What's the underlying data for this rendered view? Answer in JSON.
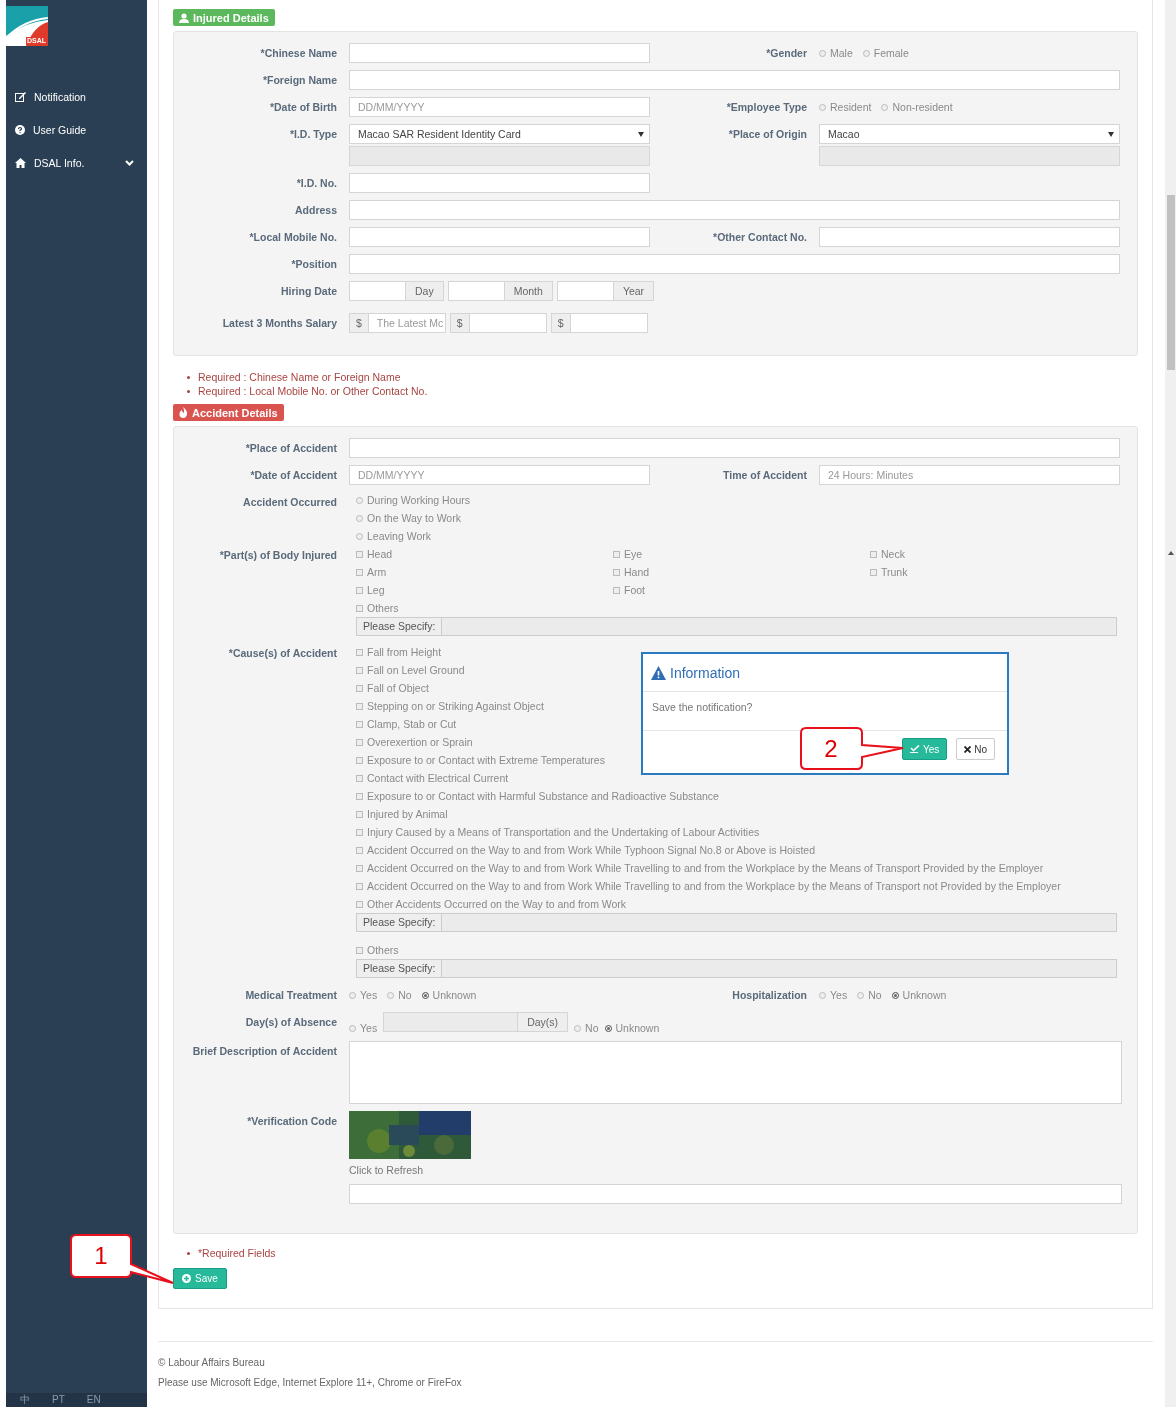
{
  "sidebar": {
    "logo_text": "DSAL",
    "items": [
      {
        "label": "Notification",
        "has_submenu": false
      },
      {
        "label": "User Guide",
        "has_submenu": false
      },
      {
        "label": "DSAL Info.",
        "has_submenu": true
      }
    ],
    "languages": [
      "中",
      "PT",
      "EN"
    ]
  },
  "injured": {
    "title": "Injured Details",
    "rows": [
      {
        "fields": [
          {
            "label": "*Chinese Name",
            "kind": "text"
          },
          {
            "label": "*Gender",
            "kind": "radio",
            "options": [
              {
                "label": "Male",
                "selected": false
              },
              {
                "label": "Female",
                "selected": false
              }
            ]
          }
        ]
      },
      {
        "fields": [
          {
            "label": "*Foreign Name",
            "kind": "text",
            "wide": true
          }
        ]
      },
      {
        "fields": [
          {
            "label": "*Date of Birth",
            "kind": "text",
            "placeholder": "DD/MM/YYYY"
          },
          {
            "label": "*Employee Type",
            "kind": "radio",
            "options": [
              {
                "label": "Resident",
                "selected": false
              },
              {
                "label": "Non-resident",
                "selected": false
              }
            ]
          }
        ]
      },
      {
        "fields": [
          {
            "label": "*I.D. Type",
            "kind": "select",
            "value": "Macao SAR Resident Identity Card",
            "extra_field": true
          },
          {
            "label": "*Place of Origin",
            "kind": "select",
            "value": "Macao",
            "extra_field": true
          }
        ]
      },
      {
        "fields": [
          {
            "label": "*I.D. No.",
            "kind": "text"
          }
        ]
      },
      {
        "fields": [
          {
            "label": "Address",
            "kind": "text",
            "wide": true
          }
        ]
      },
      {
        "fields": [
          {
            "label": "*Local Mobile No.",
            "kind": "text"
          },
          {
            "label": "*Other Contact No.",
            "kind": "text"
          }
        ]
      },
      {
        "fields": [
          {
            "label": "*Position",
            "kind": "text",
            "wide": true
          }
        ]
      },
      {
        "fields": [
          {
            "label": "Hiring Date",
            "kind": "date_parts",
            "parts": [
              "Day",
              "Month",
              "Year"
            ]
          }
        ]
      },
      {
        "fields": [
          {
            "label": "Latest 3 Months Salary",
            "kind": "salary",
            "groups": [
              {
                "prefix": "$",
                "placeholder": "The Latest Mc"
              },
              {
                "prefix": "$"
              },
              {
                "prefix": "$"
              }
            ]
          }
        ]
      }
    ]
  },
  "notes": [
    "Required : Chinese Name or Foreign Name",
    "Required : Local Mobile No. or Other Contact No."
  ],
  "accident": {
    "title": "Accident Details",
    "rows": [
      {
        "fields": [
          {
            "label": "*Place of Accident",
            "kind": "text",
            "wide": true
          }
        ]
      },
      {
        "fields": [
          {
            "label": "*Date of Accident",
            "kind": "text",
            "placeholder": "DD/MM/YYYY"
          },
          {
            "label": "Time of Accident",
            "kind": "text",
            "placeholder": "24 Hours: Minutes"
          }
        ]
      },
      {
        "fields": [
          {
            "label": "Accident Occurred",
            "kind": "radio_list",
            "options": [
              {
                "label": "During Working Hours",
                "selected": false
              },
              {
                "label": "On the Way to Work",
                "selected": false
              },
              {
                "label": "Leaving Work",
                "selected": false
              }
            ]
          }
        ]
      },
      {
        "fields": [
          {
            "label": "*Part(s) of Body Injured",
            "kind": "checkgrid",
            "options": [
              {
                "label": "Head",
                "checked": false
              },
              {
                "label": "Eye",
                "checked": false
              },
              {
                "label": "Neck",
                "checked": false
              },
              {
                "label": "Arm",
                "checked": false
              },
              {
                "label": "Hand",
                "checked": false
              },
              {
                "label": "Trunk",
                "checked": false
              },
              {
                "label": "Leg",
                "checked": false
              },
              {
                "label": "Foot",
                "checked": false
              }
            ],
            "other": {
              "label": "Others",
              "checked": false,
              "specify": "Please Specify:"
            }
          }
        ]
      },
      {
        "fields": [
          {
            "label": "*Cause(s) of Accident",
            "kind": "checklist",
            "options": [
              {
                "label": "Fall from Height",
                "checked": false
              },
              {
                "label": "Fall on Level Ground",
                "checked": false
              },
              {
                "label": "Fall of Object",
                "checked": false
              },
              {
                "label": "Stepping on or Striking Against Object",
                "checked": false
              },
              {
                "label": "Clamp, Stab or Cut",
                "checked": false
              },
              {
                "label": "Overexertion or Sprain",
                "checked": false
              },
              {
                "label": "Exposure to or Contact with Extreme Temperatures",
                "checked": false
              },
              {
                "label": "Contact with Electrical Current",
                "checked": false
              },
              {
                "label": "Exposure to or Contact with Harmful Substance and Radioactive Substance",
                "checked": false
              },
              {
                "label": "Injured by Animal",
                "checked": false
              },
              {
                "label": "Injury Caused by a Means of Transportation and the Undertaking of Labour Activities",
                "checked": false
              },
              {
                "label": "Accident Occurred on the Way to and from Work While Typhoon Signal No.8 or Above is Hoisted",
                "checked": false
              },
              {
                "label": "Accident Occurred on the Way to and from Work While Travelling to and from the Workplace by the Means of Transport Provided by the Employer",
                "checked": false
              },
              {
                "label": "Accident Occurred on the Way to and from Work While Travelling to and from the Workplace by the Means of Transport not Provided by the Employer",
                "checked": false
              },
              {
                "label": "Other Accidents Occurred on the Way to and from Work",
                "checked": false,
                "specify": "Please Specify:"
              },
              {
                "label": "Others",
                "checked": false,
                "specify": "Please Specify:"
              }
            ]
          }
        ]
      },
      {
        "fields": [
          {
            "label": "Medical Treatment",
            "kind": "radio",
            "options": [
              {
                "label": "Yes",
                "selected": false
              },
              {
                "label": "No",
                "selected": false
              },
              {
                "label": "Unknown",
                "selected": true
              }
            ]
          },
          {
            "label": "Hospitalization",
            "kind": "radio",
            "options": [
              {
                "label": "Yes",
                "selected": false
              },
              {
                "label": "No",
                "selected": false
              },
              {
                "label": "Unknown",
                "selected": true
              }
            ]
          }
        ]
      },
      {
        "fields": [
          {
            "label": "Day(s) of Absence",
            "kind": "absence",
            "unit": "Day(s)",
            "options": [
              {
                "label": "Yes",
                "selected": false
              },
              {
                "label": "No",
                "selected": false
              },
              {
                "label": "Unknown",
                "selected": true
              }
            ]
          }
        ]
      },
      {
        "fields": [
          {
            "label": "Brief Description of Accident",
            "kind": "textarea"
          }
        ]
      },
      {
        "fields": [
          {
            "label": "*Verification Code",
            "kind": "captcha",
            "refresh_label": "Click to Refresh"
          }
        ]
      }
    ]
  },
  "required_note": "*Required Fields",
  "save_button": "Save",
  "footer": [
    "© Labour Affairs Bureau",
    "Please use Microsoft Edge, Internet Explore 11+, Chrome or FireFox"
  ],
  "dialog": {
    "title": "Information",
    "message": "Save the notification?",
    "buttons": [
      {
        "label": "Yes",
        "kind": "primary"
      },
      {
        "label": "No",
        "kind": "default"
      }
    ]
  },
  "callouts": [
    "1",
    "2"
  ]
}
